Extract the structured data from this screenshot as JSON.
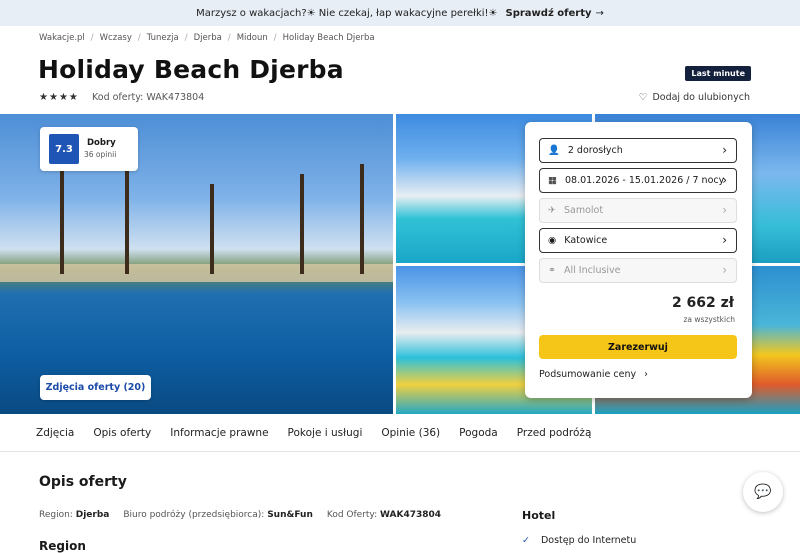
{
  "promo": {
    "text": "Marzysz o wakacjach?☀ Nie czekaj, łap wakacyjne perełki!☀",
    "cta": "Sprawdź oferty"
  },
  "breadcrumb": [
    "Wakacje.pl",
    "Wczasy",
    "Tunezja",
    "Djerba",
    "Midoun",
    "Holiday Beach Djerba"
  ],
  "hotel": {
    "title": "Holiday Beach Djerba",
    "badge": "Last minute",
    "stars": 4,
    "offer_code_label": "Kod oferty: WAK473804",
    "favorite": "Dodaj do ulubionych"
  },
  "rating": {
    "score": "7.3",
    "label": "Dobry",
    "count": "36 opinii"
  },
  "photos_button": "Zdjęcia oferty (20)",
  "booking": {
    "guests": "2 dorosłych",
    "dates": "08.01.2026 - 15.01.2026 / 7 nocy",
    "transport": "Samolot",
    "departure": "Katowice",
    "board": "All Inclusive",
    "price": "2 662 zł",
    "price_note": "za wszystkich",
    "book": "Zarezerwuj",
    "summary": "Podsumowanie ceny"
  },
  "tabs": [
    "Zdjęcia",
    "Opis oferty",
    "Informacje prawne",
    "Pokoje i usługi",
    "Opinie (36)",
    "Pogoda",
    "Przed podróżą"
  ],
  "description": {
    "heading": "Opis oferty",
    "region_label": "Region:",
    "region_value": "Djerba",
    "operator_label": "Biuro podróży (przedsiębiorca):",
    "operator_value": "Sun&Fun",
    "code_label": "Kod Oferty:",
    "code_value": "WAK473804",
    "region_heading": "Region"
  },
  "hotel_section": {
    "heading": "Hotel",
    "amenity": "Dostęp do Internetu"
  },
  "colors": {
    "accent_blue": "#1f55b5",
    "cta_yellow": "#f5c518",
    "badge_navy": "#14213d"
  }
}
